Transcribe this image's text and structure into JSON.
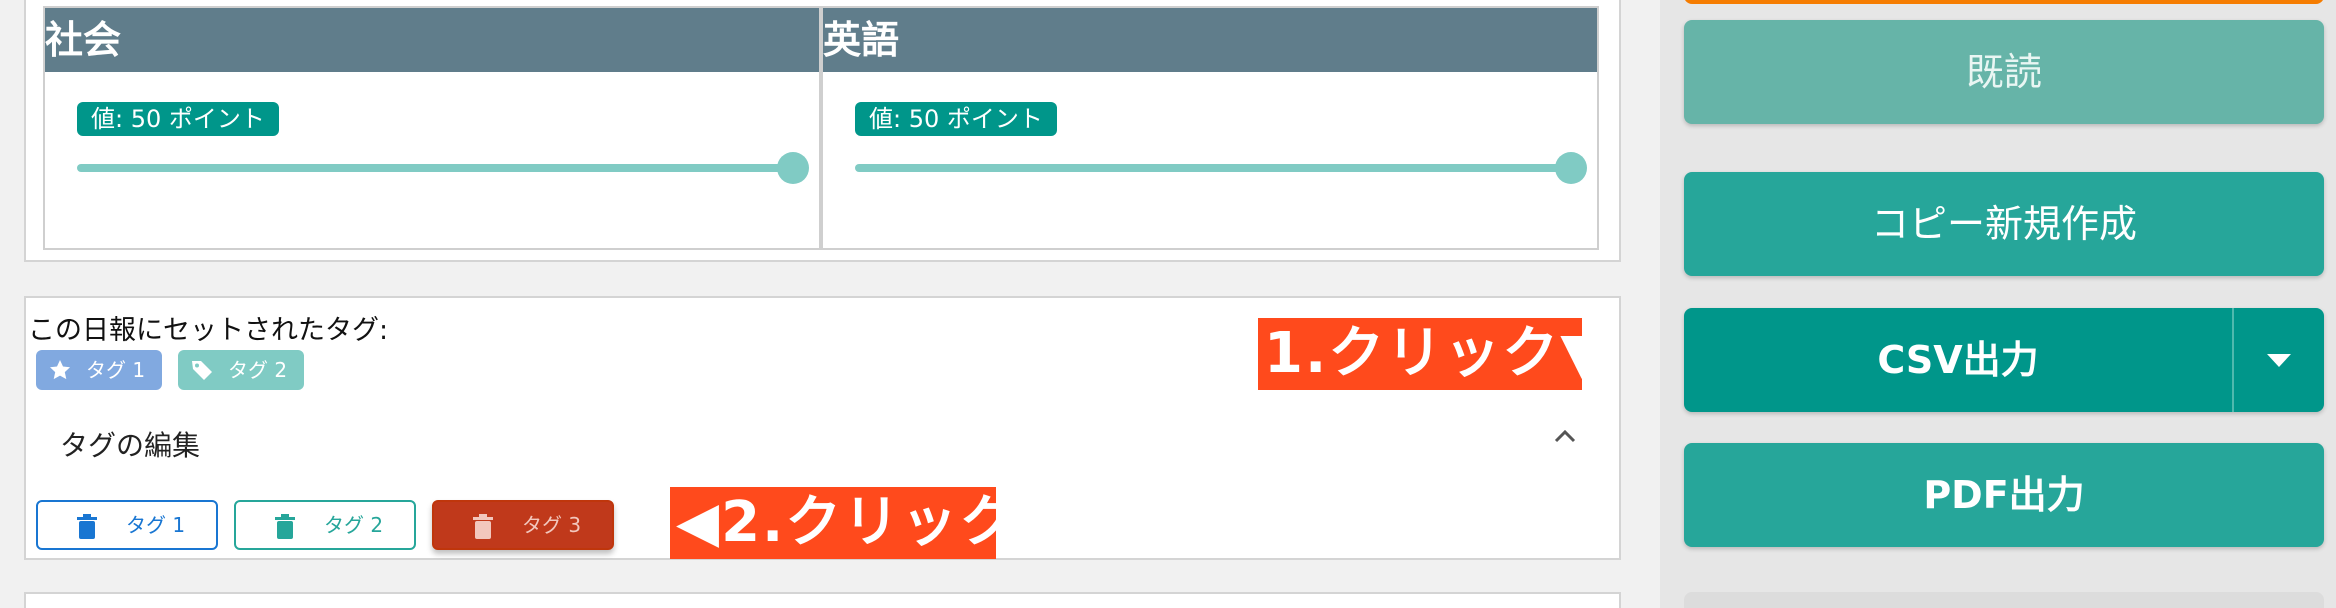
{
  "scores": {
    "columns": [
      {
        "subject": "社会",
        "value_label": "値: 50 ポイント",
        "value": 50
      },
      {
        "subject": "英語",
        "value_label": "値: 50 ポイント",
        "value": 50
      }
    ]
  },
  "tags": {
    "heading": "この日報にセットされたタグ:",
    "chips": [
      {
        "label": "タグ 1",
        "icon": "star-icon",
        "color": "#81a9e0"
      },
      {
        "label": "タグ 2",
        "icon": "tag-icon",
        "color": "#80cbc4"
      }
    ],
    "edit_section": {
      "label": "タグの編集",
      "expanded": true,
      "buttons": [
        {
          "label": "タグ 1",
          "icon": "trash-icon",
          "color": "#1976d2"
        },
        {
          "label": "タグ 2",
          "icon": "trash-icon",
          "color": "#26a69a"
        },
        {
          "label": "タグ 3",
          "icon": "trash-icon",
          "color": "#c0391b"
        }
      ]
    }
  },
  "annotations": {
    "step1": "1.クリック▼",
    "step2": "◀2.クリック"
  },
  "sidebar": {
    "read_button": "既読",
    "copy_button": "コピー新規作成",
    "csv_button": "CSV出力",
    "pdf_button": "PDF出力"
  },
  "colors": {
    "header_bg": "#607d8b",
    "accent": "#00968a",
    "annotation": "#ff4a1c",
    "orange_bar": "#f57c00"
  }
}
